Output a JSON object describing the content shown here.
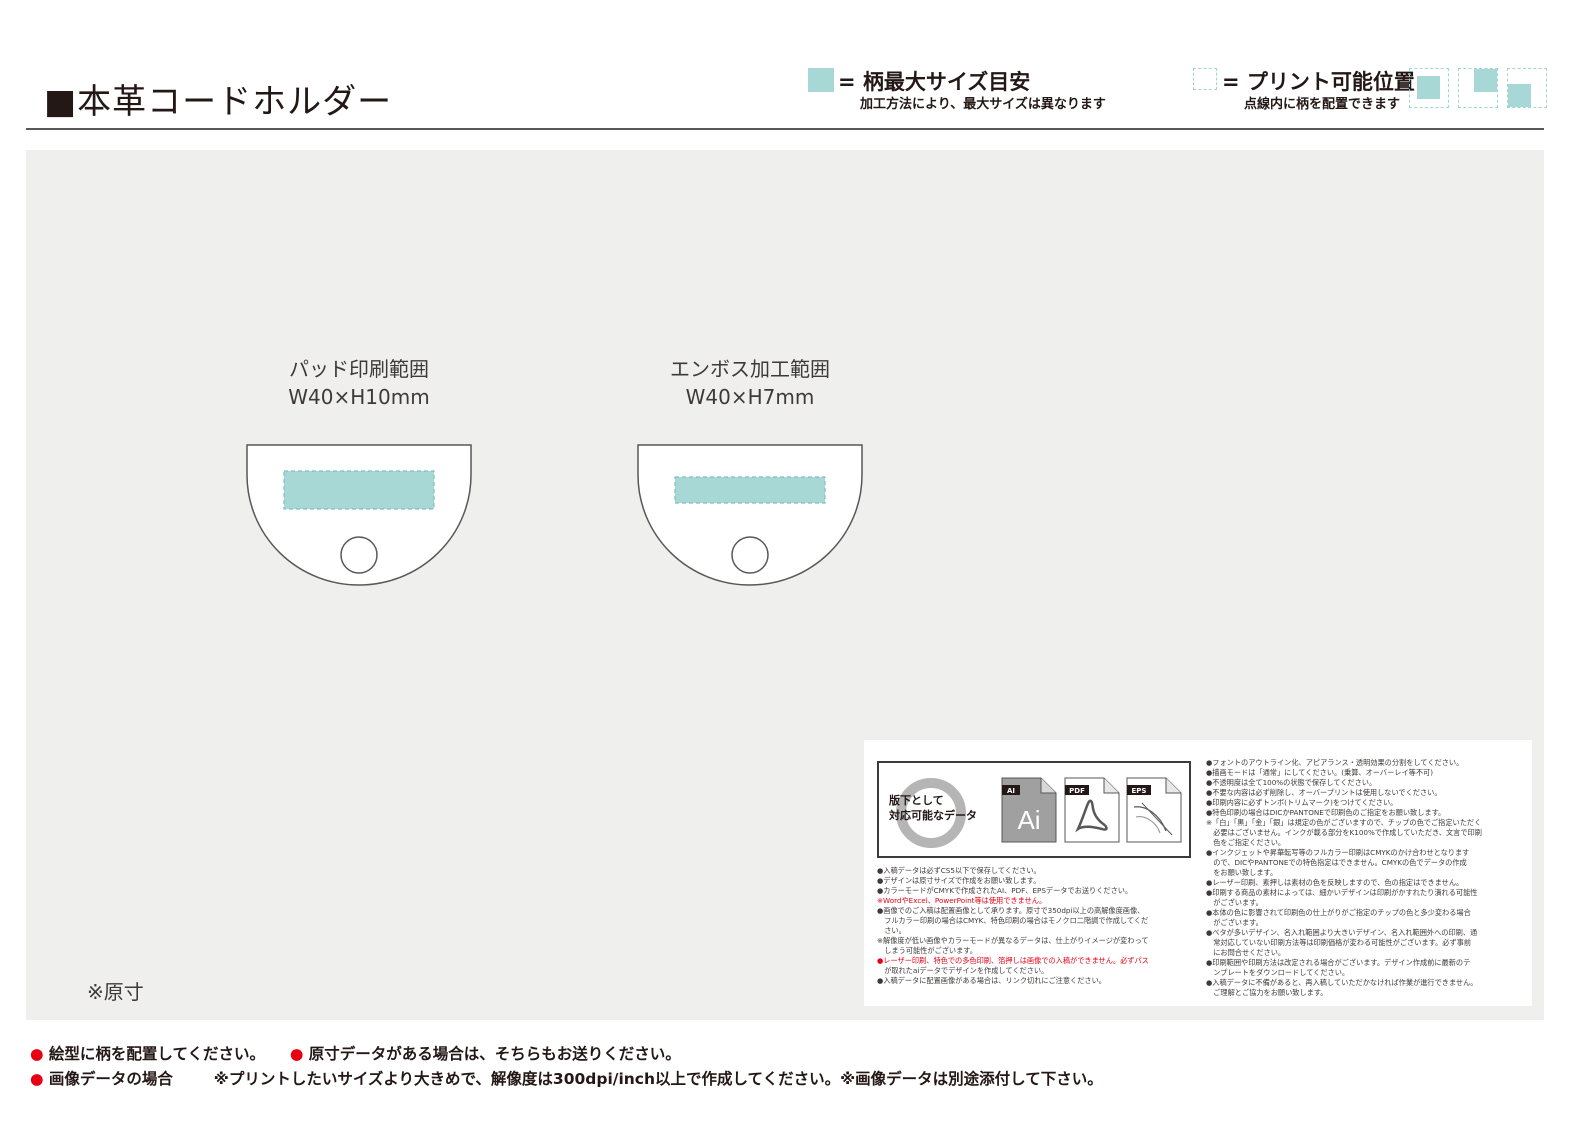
{
  "header": {
    "title": "■本革コードホルダー",
    "legend_max_size": {
      "label": "= 柄最大サイズ目安",
      "sub": "加工方法により、最大サイズは異なります",
      "swatch_color": "#a8d8d6"
    },
    "legend_print_position": {
      "label": "= プリント可能位置",
      "sub": "点線内に柄を配置できます",
      "line_color": "#9fd5d3"
    }
  },
  "templates": [
    {
      "name_line": "パッド印刷範囲",
      "size_line": "W40×H10mm"
    },
    {
      "name_line": "エンボス加工範囲",
      "size_line": "W40×H7mm"
    }
  ],
  "actual_size_note": "※原寸",
  "data_panel": {
    "badge_text_line1": "版下として",
    "badge_text_line2": "対応可能なデータ",
    "formats": [
      {
        "tag": "AI",
        "glyph": "Ai",
        "icon": "illustrator-file-icon"
      },
      {
        "tag": "PDF",
        "glyph": "",
        "icon": "pdf-file-icon"
      },
      {
        "tag": "EPS",
        "glyph": "",
        "icon": "eps-file-icon"
      }
    ],
    "notes_left": [
      "●入稿データは必ずCS5以下で保存してください。",
      "●デザインは原寸サイズで作成をお願い致します。",
      "●カラーモードがCMYKで作成されたAI、PDF、EPSデータでお送りください。",
      "※WordやExcel、PowerPoint等は使用できません。",
      "●画像でのご入稿は配置画像として承ります。原寸で350dpi以上の高解像度画像、",
      "　フルカラー印刷の場合はCMYK、特色印刷の場合はモノクロ二階調で作成してくだ",
      "　さい。",
      "※解像度が低い画像やカラーモードが異なるデータは、仕上がりイメージが変わって",
      "　しまう可能性がございます。",
      "●レーザー印刷、特色での多色印刷、箔押しは画像での入稿ができません。必ずパス",
      "　が取れたaiデータでデザインを作成してください。",
      "●入稿データに配置画像がある場合は、リンク切れにご注意ください。"
    ],
    "notes_right": [
      "●フォントのアウトライン化、アピアランス・透明効果の分割をしてください。",
      "●描画モードは「通常」にしてください。(乗算、オーバーレイ等不可)",
      "●不透明度は全て100%の状態で保存してください。",
      "●不要な内容は必ず削除し、オーバープリントは使用しないでください。",
      "●印刷内容に必ずトンボ(トリムマーク)をつけてください。",
      "●特色印刷の場合はDICかPANTONEで印刷色のご指定をお願い致します。",
      "※「白」「黒」「金」「銀」は規定の色がございますので、チップの色でご指定いただく",
      "　必要はございません。インクが載る部分をK100%で作成していただき、文言で印刷",
      "　色をご指定ください。",
      "●インクジェットや昇華転写等のフルカラー印刷はCMYKのかけ合わせとなります",
      "　ので、DICやPANTONEでの特色指定はできません。CMYKの色でデータの作成",
      "　をお願い致します。",
      "●レーザー印刷、素押しは素材の色を反映しますので、色の指定はできません。",
      "●印刷する商品の素材によっては、細かいデザインは印刷がかすれたり潰れる可能性",
      "　がございます。",
      "●本体の色に影響されて印刷色の仕上がりがご指定のチップの色と多少変わる場合",
      "　がございます。",
      "●ベタが多いデザイン、名入れ範囲より大きいデザイン、名入れ範囲外への印刷、通",
      "　常対応していない印刷方法等は印刷価格が変わる可能性がございます。必ず事前",
      "　にお問合せください。",
      "●印刷範囲や印刷方法は改定される場合がございます。デザイン作成前に最新のテ",
      "　ンプレートをダウンロードしてください。",
      "●入稿データに不備があると、再入稿していただかなければ作業が進行できません。",
      "　ご理解とご協力をお願い致します。"
    ]
  },
  "footer": {
    "line1_a": "● 絵型に柄を配置してください。",
    "line1_b": "● 原寸データがある場合は、そちらもお送りください。",
    "line2_a": "● 画像データの場合",
    "line2_b": "※プリントしたいサイズより大きめで、解像度は300dpi/inch以上で作成してください。※画像データは別途添付して下さい。"
  },
  "colors": {
    "accent_fill": "#a8d8d6",
    "dashed_line": "#9fd5d3",
    "canvas_bg": "#efefee",
    "bullet_red": "#e60012"
  }
}
